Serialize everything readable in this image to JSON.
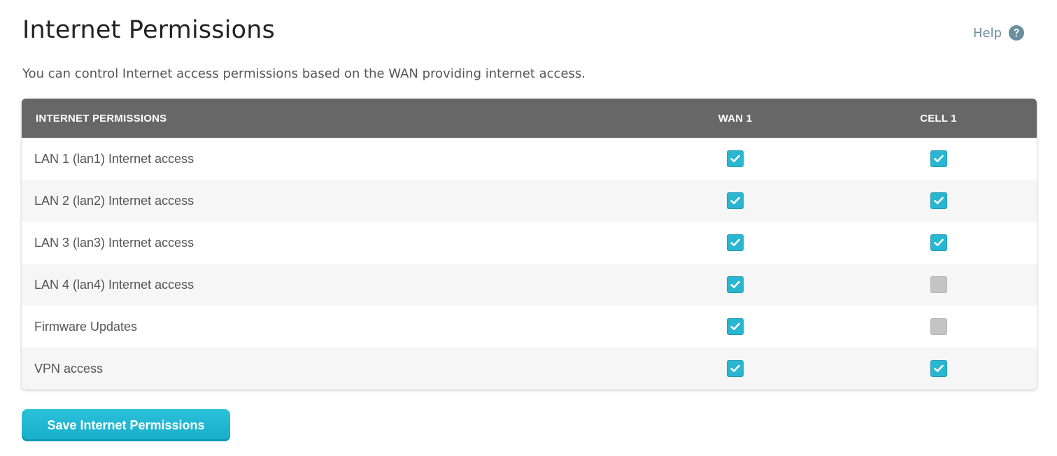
{
  "header": {
    "title": "Internet Permissions",
    "help_label": "Help"
  },
  "description": "You can control Internet access permissions based on the WAN providing internet access.",
  "table": {
    "columns": [
      "INTERNET PERMISSIONS",
      "WAN 1",
      "CELL 1"
    ],
    "rows": [
      {
        "label": "LAN 1 (lan1) Internet access",
        "wan1": true,
        "cell1": true
      },
      {
        "label": "LAN 2 (lan2) Internet access",
        "wan1": true,
        "cell1": true
      },
      {
        "label": "LAN 3 (lan3) Internet access",
        "wan1": true,
        "cell1": true
      },
      {
        "label": "LAN 4 (lan4) Internet access",
        "wan1": true,
        "cell1": false
      },
      {
        "label": "Firmware Updates",
        "wan1": true,
        "cell1": false
      },
      {
        "label": "VPN access",
        "wan1": true,
        "cell1": true
      }
    ]
  },
  "save_button": {
    "label": "Save Internet Permissions"
  },
  "colors": {
    "accent": "#29b6d1",
    "header_bg": "#676767",
    "unchecked": "#c4c4c4",
    "help": "#6b8f9e"
  },
  "icons": {
    "help": "question-circle-icon",
    "check": "checkmark-icon"
  }
}
